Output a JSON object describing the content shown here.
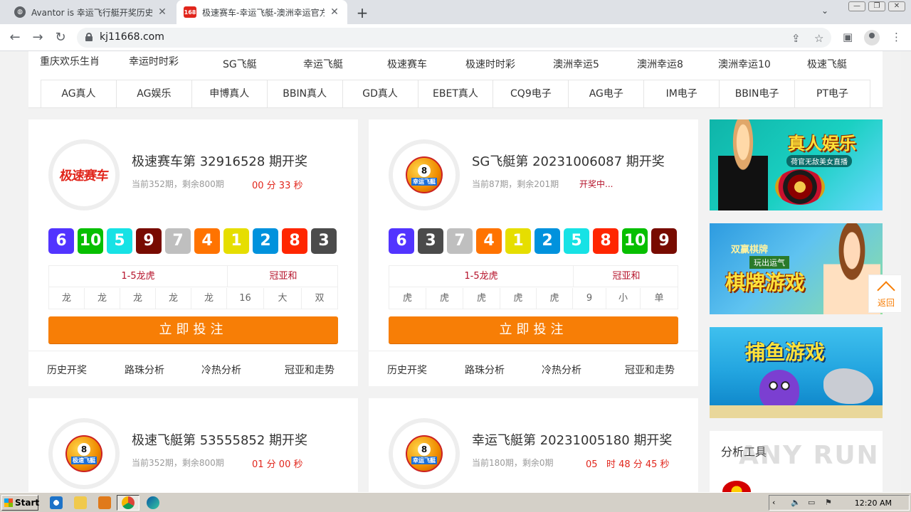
{
  "browser": {
    "tabs": [
      {
        "title": "Avantor is 幸运飞行艇开奖历史记录",
        "favicon": "globe-icon",
        "active": false
      },
      {
        "title": "极速赛车-幸运飞艇-澳洲幸运官方体",
        "favicon_text": "168",
        "active": true
      }
    ],
    "url": "kj11668.com"
  },
  "menu": {
    "row1": [
      "重庆欢乐生肖",
      "幸运时时彩",
      "SG飞艇",
      "幸运飞艇",
      "极速赛车",
      "极速时时彩",
      "澳洲幸运5",
      "澳洲幸运8",
      "澳洲幸运10",
      "极速飞艇"
    ],
    "row2": [
      "AG真人",
      "AG娱乐",
      "申博真人",
      "BBIN真人",
      "GD真人",
      "EBET真人",
      "CQ9电子",
      "AG电子",
      "IM电子",
      "BBIN电子",
      "PT电子"
    ]
  },
  "cards": [
    {
      "logo": "极速赛车",
      "title": "极速赛车第 32916528 期开奖",
      "sub": "当前352期，剩余800期",
      "timer": "00 分 33 秒",
      "balls": [
        "6",
        "10",
        "5",
        "9",
        "7",
        "4",
        "1",
        "2",
        "8",
        "3"
      ],
      "stats_head": [
        "1-5龙虎",
        "冠亚和"
      ],
      "stats": [
        "龙",
        "龙",
        "龙",
        "龙",
        "龙",
        "16",
        "大",
        "双"
      ],
      "bet": "立即投注",
      "links": [
        "历史开奖",
        "路珠分析",
        "冷热分析",
        "冠亚和走势"
      ]
    },
    {
      "logo_sub": "幸运飞艇",
      "title": "SG飞艇第 20231006087 期开奖",
      "sub": "当前87期，剩余201期",
      "timer": "开奖中...",
      "balls": [
        "6",
        "3",
        "7",
        "4",
        "1",
        "2",
        "5",
        "8",
        "10",
        "9"
      ],
      "stats_head": [
        "1-5龙虎",
        "冠亚和"
      ],
      "stats": [
        "虎",
        "虎",
        "虎",
        "虎",
        "虎",
        "9",
        "小",
        "单"
      ],
      "bet": "立即投注",
      "links": [
        "历史开奖",
        "路珠分析",
        "冷热分析",
        "冠亚和走势"
      ]
    },
    {
      "logo_sub": "极速飞艇",
      "title": "极速飞艇第 53555852 期开奖",
      "sub": "当前352期，剩余800期",
      "timer": "01 分 00 秒"
    },
    {
      "logo_sub": "幸运飞艇",
      "title": "幸运飞艇第 20231005180 期开奖",
      "sub": "当前180期，剩余0期",
      "timer": "05   时 48 分 45 秒"
    }
  ],
  "ball_colors": {
    "1": "#e6de00",
    "2": "#0092dd",
    "3": "#4b4b4b",
    "4": "#ff7300",
    "5": "#17e2e5",
    "6": "#5234ff",
    "7": "#bfbfbf",
    "8": "#ff2600",
    "9": "#780b00",
    "10": "#07bf00"
  },
  "banners": {
    "live": "真人娱乐",
    "live_sub": "荷官无敌美女直播",
    "chess_small": "双赢棋牌",
    "chess_sub": "玩出运气",
    "chess": "棋牌游戏",
    "fish": "捕鱼游戏"
  },
  "sidebar": {
    "tools_title": "分析工具",
    "back_top": "返回"
  },
  "watermark": "ANY RUN",
  "taskbar": {
    "start": "Start",
    "clock": "12:20 AM"
  }
}
